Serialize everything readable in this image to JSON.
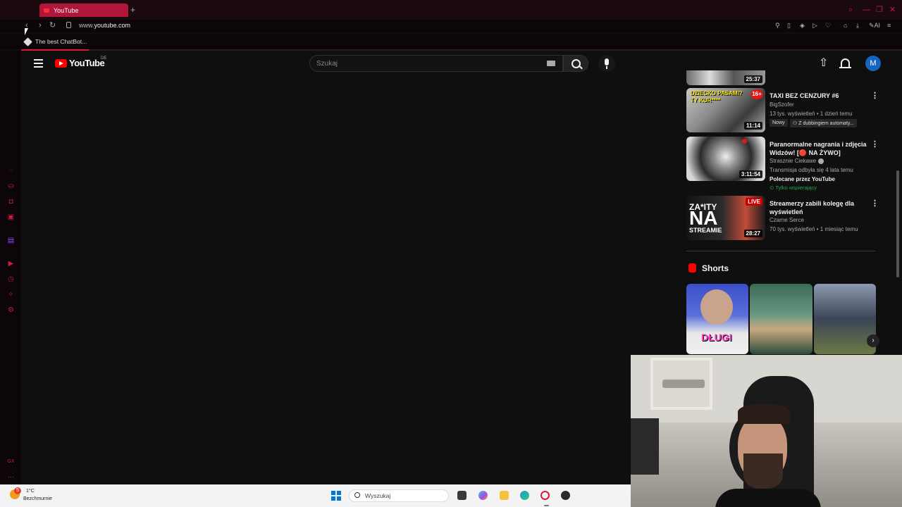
{
  "browser": {
    "tab_title": "YouTube",
    "url_prefix": "www.",
    "url_host": "youtube.com",
    "bookmark_label": "The best ChatBot...",
    "ai_label": "AI"
  },
  "youtube": {
    "logo_text": "YouTube",
    "country_code": "DE",
    "search_placeholder": "Szukaj",
    "avatar_letter": "M"
  },
  "recommendations": [
    {
      "title": "TAXI BEZ CENZURY #6",
      "channel": "BigSzofer",
      "meta": "13 tys. wyświetleń • 1 dzień temu",
      "chip_new": "Nowy",
      "chip_dub": "Z dubbingiem automaty...",
      "duration": "11:14",
      "thumb_text": "DZIECKO PASAMI? TY KUR****"
    },
    {
      "title": "Paranormalne nagrania i zdjęcia Widzów! [🔴 NA ŻYWO]",
      "channel": "Strasznie Ciekawe",
      "meta": "Transmisja odbyła się 4 lata temu",
      "promo": "Polecane przez YouTube",
      "members": "Tylko wspierający",
      "duration": "3:11:54"
    },
    {
      "title": "Streamerzy zabili kolegę dla wyświetleń",
      "channel": "Czarne Serce",
      "meta": "70 tys. wyświetleń • 1 miesiąc temu",
      "duration": "28:27",
      "live_label": "LIVE",
      "thumb_text_1": "ZA*ITY",
      "thumb_text_2": "NA",
      "thumb_text_3": "STREAMIE"
    }
  ],
  "partial_top_duration": "25:37",
  "shorts": {
    "title": "Shorts",
    "first_short_text": "DŁUGI"
  },
  "taskbar": {
    "weather_badge": "5",
    "temperature": "1°C",
    "weather_desc": "Bezchmurnie",
    "search_label": "Wyszukaj"
  },
  "colors": {
    "accent": "#c51d3a",
    "youtube_red": "#ff0000",
    "background": "#0f0f0f"
  }
}
